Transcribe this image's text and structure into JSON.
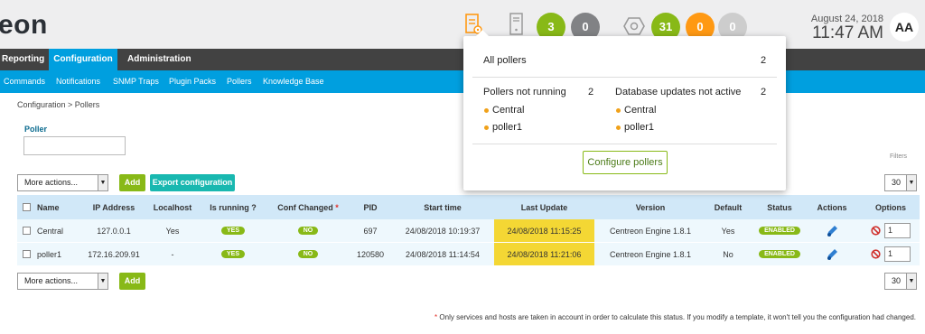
{
  "app": {
    "logo_text": "eon"
  },
  "header": {
    "poller_icon": "poller-config-icon",
    "server_icon": "server-icon",
    "hex_icon": "hexagon-icon",
    "hosts_counts": [
      "3",
      "0"
    ],
    "services_counts": [
      "31",
      "0",
      "0"
    ],
    "date": "August 24, 2018",
    "time": "11:47 AM",
    "avatar": "AA"
  },
  "colors": {
    "green": "#88b917",
    "orange": "#ff9913",
    "blue": "#009fdf",
    "highlight": "#f4d734",
    "menu_bg": "#424242"
  },
  "menu": {
    "items": [
      "Reporting",
      "Configuration",
      "Administration"
    ],
    "active": "Configuration"
  },
  "submenu": {
    "items": [
      "Commands",
      "Notifications",
      "SNMP Traps",
      "Plugin Packs",
      "Pollers",
      "Knowledge Base"
    ]
  },
  "breadcrumb": "Configuration  >  Pollers",
  "filter": {
    "label": "Poller",
    "value": "",
    "filters_label": "Filters"
  },
  "actions": {
    "more_actions": "More actions...",
    "add": "Add",
    "export": "Export configuration",
    "per_page": "30"
  },
  "table": {
    "headers": [
      "Name",
      "IP Address",
      "Localhost",
      "Is running ?",
      "Conf Changed",
      "PID",
      "Start time",
      "Last Update",
      "Version",
      "Default",
      "Status",
      "Actions",
      "Options"
    ],
    "conf_star": "*",
    "rows": [
      {
        "name": "Central",
        "ip": "127.0.0.1",
        "localhost": "Yes",
        "running": "YES",
        "conf_changed": "NO",
        "pid": "697",
        "start": "24/08/2018 10:19:37",
        "last_update": "24/08/2018 11:15:25",
        "version": "Centreon Engine 1.8.1",
        "default": "Yes",
        "status": "ENABLED",
        "option_value": "1"
      },
      {
        "name": "poller1",
        "ip": "172.16.209.91",
        "localhost": "-",
        "running": "YES",
        "conf_changed": "NO",
        "pid": "120580",
        "start": "24/08/2018 11:14:54",
        "last_update": "24/08/2018 11:21:06",
        "version": "Centreon Engine 1.8.1",
        "default": "No",
        "status": "ENABLED",
        "option_value": "1"
      }
    ]
  },
  "footnote": {
    "star": "*",
    "text": " Only services and hosts are taken in account in order to calculate this status. If you modify a template, it won't tell you the configuration had changed."
  },
  "popover": {
    "all_label": "All pollers",
    "all_count": "2",
    "not_running_label": "Pollers not running",
    "not_running_count": "2",
    "not_running_items": [
      "Central",
      "poller1"
    ],
    "db_label": "Database updates not active",
    "db_count": "2",
    "db_items": [
      "Central",
      "poller1"
    ],
    "button": "Configure pollers"
  }
}
